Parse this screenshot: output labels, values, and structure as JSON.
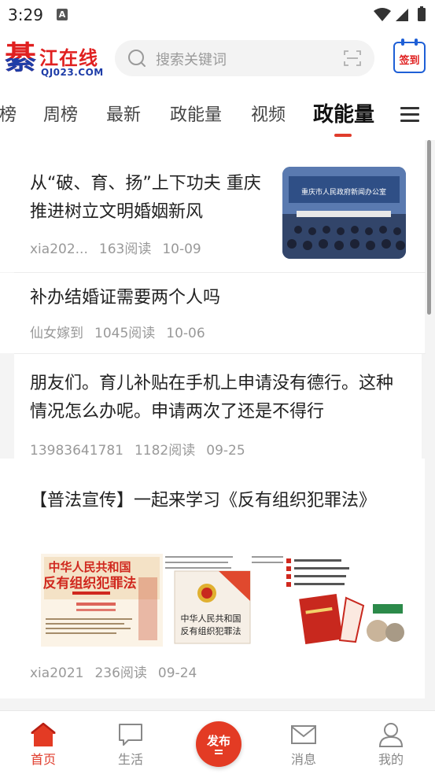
{
  "status_bar": {
    "time": "3:29",
    "notification_icon": "A"
  },
  "header": {
    "logo_char": "綦",
    "logo_brand": "江在线",
    "logo_domain": "QJ023.COM",
    "search_placeholder": "搜索关键词",
    "signin_label": "签到"
  },
  "tabs": [
    {
      "label": "榜"
    },
    {
      "label": "周榜"
    },
    {
      "label": "最新"
    },
    {
      "label": "政能量"
    },
    {
      "label": "视频"
    },
    {
      "label": "政能量",
      "active": true
    }
  ],
  "feed": [
    {
      "title": "从“破、育、扬”上下功夫 重庆推进树立文明婚姻新风",
      "author": "xia202...",
      "reads": "163阅读",
      "date": "10-09",
      "thumb_caption": "重庆市人民政府新闻办公室"
    },
    {
      "title": "补办结婚证需要两个人吗",
      "author": "仙女嫁到",
      "reads": "1045阅读",
      "date": "10-06"
    },
    {
      "title": "朋友们。育儿补贴在手机上申请没有德行。这种情况怎么办呢。申请两次了还是不得行",
      "author": "13983641781",
      "reads": "1182阅读",
      "date": "09-25"
    },
    {
      "title": "【普法宣传】一起来学习《反有组织犯罪法》",
      "author": "xia2021",
      "reads": "236阅读",
      "date": "09-24",
      "images": [
        {
          "heading1": "中华人民共和国",
          "heading2": "反有组织犯罪法"
        },
        {
          "heading1": "中华人民共和国",
          "heading2": "反有组织犯罪法"
        },
        {
          "heading1": "",
          "heading2": ""
        }
      ]
    }
  ],
  "bottom_nav": [
    {
      "label": "首页",
      "active": true
    },
    {
      "label": "生活"
    },
    {
      "label": "发布"
    },
    {
      "label": "消息"
    },
    {
      "label": "我的"
    }
  ],
  "colors": {
    "accent": "#e33b24",
    "logo_red": "#e02020",
    "logo_blue": "#1e3da8"
  }
}
